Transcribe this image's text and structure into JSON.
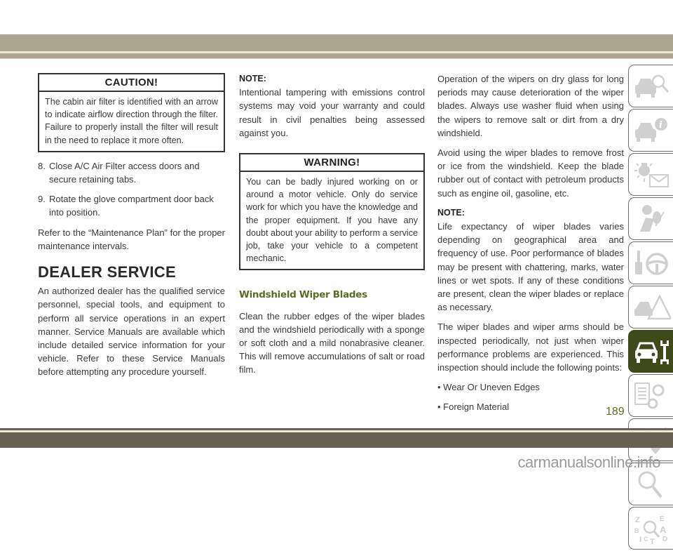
{
  "caution": {
    "title": "CAUTION!",
    "body": "The cabin air filter is identified with an arrow to indicate airflow direction through the filter. Failure to properly install the filter will result in the need to replace it more often."
  },
  "steps": [
    {
      "num": "8.",
      "text": "Close A/C Air Filter access doors and secure retaining tabs."
    },
    {
      "num": "9.",
      "text": "Rotate the glove compartment door back into position."
    }
  ],
  "refer_text": "Refer to the “Maintenance Plan” for the proper maintenance intervals.",
  "dealer_service": {
    "heading": "DEALER SERVICE",
    "body": "An authorized dealer has the qualified service personnel, special tools, and equipment to perform all service operations in an expert manner. Service Manuals are available which include detailed service information for your vehicle. Refer to these Service Manuals before attempting any procedure yourself."
  },
  "note1": {
    "label": "NOTE:",
    "body": "Intentional tampering with emissions control systems may void your warranty and could result in civil penalties being assessed against you."
  },
  "warning": {
    "title": "WARNING!",
    "body": "You can be badly injured working on or around a motor vehicle. Only do service work for which you have the knowledge and the proper equipment. If you have any doubt about your ability to perform a service job, take your vehicle to a competent mechanic."
  },
  "wiper": {
    "heading": "Windshield Wiper Blades",
    "para1": "Clean the rubber edges of the wiper blades and the windshield periodically with a sponge or soft cloth and a mild nonabrasive cleaner. This will remove accumulations of salt or road film.",
    "para2": "Operation of the wipers on dry glass for long periods may cause deterioration of the wiper blades. Always use washer fluid when using the wipers to remove salt or dirt from a dry windshield.",
    "para3": "Avoid using the wiper blades to remove frost or ice from the windshield. Keep the blade rubber out of contact with petroleum products such as engine oil, gasoline, etc.",
    "note_label": "NOTE:",
    "note_body": "Life expectancy of wiper blades varies depending on geographical area and frequency of use. Poor performance of blades may be present with chattering, marks, water lines or wet spots. If any of these conditions are present, clean the wiper blades or replace as necessary.",
    "para4": "The wiper blades and wiper arms should be inspected periodically, not just when wiper performance problems are experienced. This inspection should include the following points:",
    "bullets": [
      "• Wear Or Uneven Edges",
      "• Foreign Material"
    ]
  },
  "tabs": [
    {
      "icon": "car-search-icon",
      "active": false
    },
    {
      "icon": "car-info-icon",
      "active": false
    },
    {
      "icon": "warning-light-message-icon",
      "active": false
    },
    {
      "icon": "airbag-seat-icon",
      "active": false
    },
    {
      "icon": "key-steering-wheel-icon",
      "active": false
    },
    {
      "icon": "car-emergency-icon",
      "active": false
    },
    {
      "icon": "car-wrench-icon",
      "active": true
    },
    {
      "icon": "specs-gears-icon",
      "active": false
    },
    {
      "icon": "multimedia-icon",
      "active": false
    },
    {
      "icon": "magnifier-icon",
      "active": false
    },
    {
      "icon": "index-icon",
      "active": false
    }
  ],
  "colors": {
    "accent_green": "#5a6e23",
    "active_tab": "#3f4a1a",
    "band_top": "#aea590",
    "band_bottom": "#676050"
  },
  "page_number": "189",
  "watermark": "carmanualsonline.info"
}
